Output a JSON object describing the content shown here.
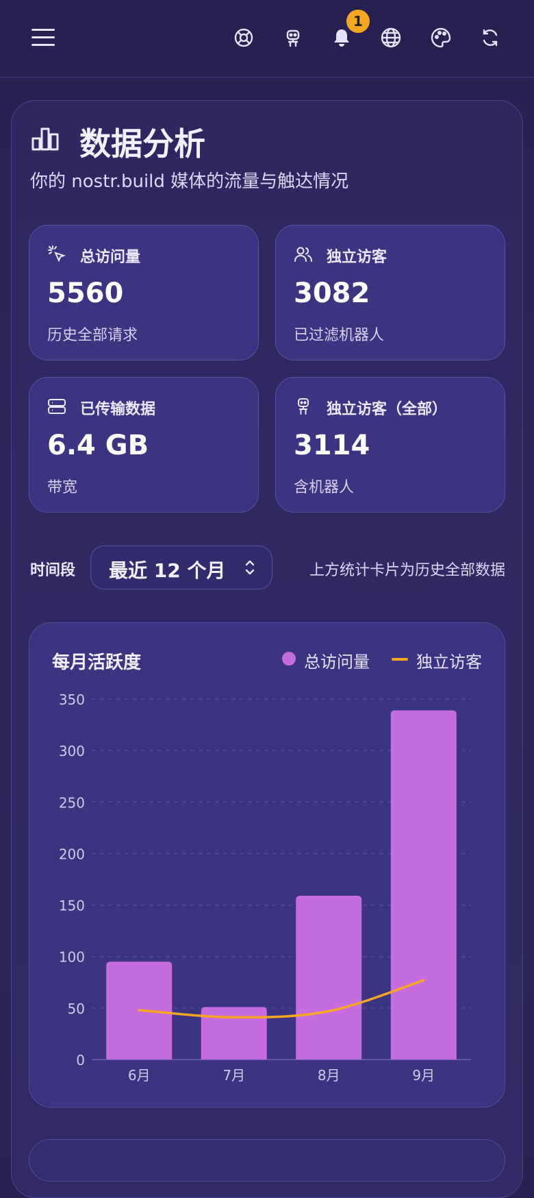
{
  "topbar": {
    "menu_icon": "hamburger-menu-icon",
    "icons": [
      "lifebuoy-icon",
      "robot-icon",
      "bell-icon",
      "globe-icon",
      "palette-icon",
      "refresh-icon"
    ],
    "notification_count": "1"
  },
  "header": {
    "title": "数据分析",
    "subtitle": "你的 nostr.build 媒体的流量与触达情况"
  },
  "stats": [
    {
      "icon": "cursor-click-icon",
      "label": "总访问量",
      "value": "5560",
      "sub": "历史全部请求"
    },
    {
      "icon": "users-icon",
      "label": "独立访客",
      "value": "3082",
      "sub": "已过滤机器人"
    },
    {
      "icon": "server-icon",
      "label": "已传输数据",
      "value": "6.4 GB",
      "sub": "带宽"
    },
    {
      "icon": "robot-icon",
      "label": "独立访客（全部）",
      "value": "3114",
      "sub": "含机器人"
    }
  ],
  "period": {
    "label": "时间段",
    "selected": "最近 12 个月",
    "note": "上方统计卡片为历史全部数据"
  },
  "chart": {
    "title": "每月活跃度",
    "legend": [
      "总访问量",
      "独立访客"
    ]
  },
  "colors": {
    "accent_bar": "#c56ddd",
    "accent_line": "#f5a623",
    "badge": "#f5a623",
    "card": "#3c3480"
  },
  "chart_data": {
    "type": "bar",
    "title": "每月活跃度",
    "categories": [
      "6月",
      "7月",
      "8月",
      "9月"
    ],
    "series": [
      {
        "name": "总访问量",
        "type": "bar",
        "values": [
          95,
          51,
          159,
          339
        ]
      },
      {
        "name": "独立访客",
        "type": "line",
        "values": [
          48,
          41,
          47,
          77
        ]
      }
    ],
    "yticks": [
      0,
      50,
      100,
      150,
      200,
      250,
      300,
      350
    ],
    "ylim": [
      0,
      350
    ],
    "grid": true,
    "legend_position": "top-right"
  }
}
